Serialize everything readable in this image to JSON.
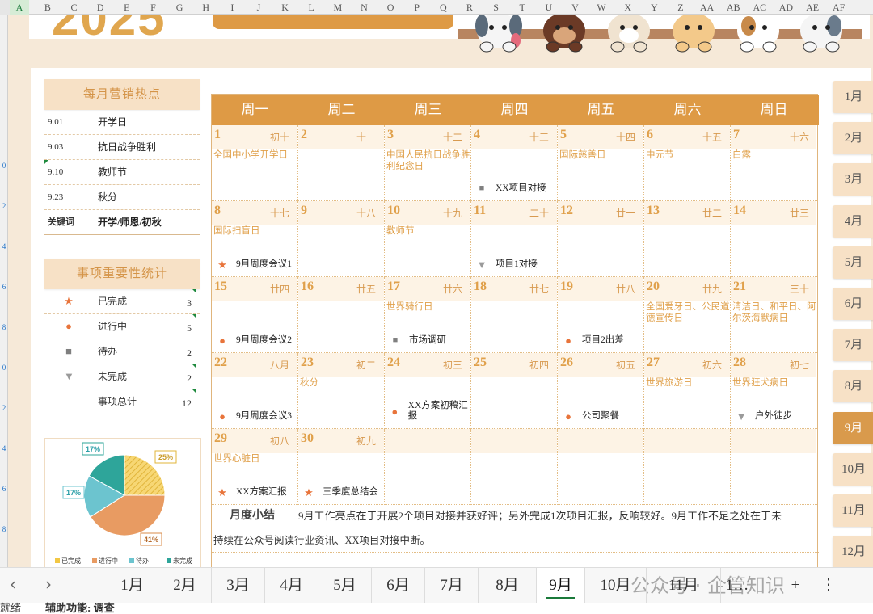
{
  "spreadsheet": {
    "columns": [
      "A",
      "B",
      "C",
      "D",
      "E",
      "F",
      "G",
      "H",
      "I",
      "J",
      "K",
      "L",
      "M",
      "N",
      "O",
      "P",
      "Q",
      "R",
      "S",
      "T",
      "U",
      "V",
      "W",
      "X",
      "Y",
      "Z",
      "AA",
      "AB",
      "AC",
      "AD",
      "AE",
      "AF"
    ],
    "selected_column": "A",
    "row_numbers": [
      "0",
      "2",
      "4",
      "6",
      "8",
      "0",
      "2",
      "4",
      "6",
      "8"
    ]
  },
  "header": {
    "year": "2025"
  },
  "marketing": {
    "title": "每月营销热点",
    "rows": [
      {
        "date": "9.01",
        "text": "开学日"
      },
      {
        "date": "9.03",
        "text": "抗日战争胜利"
      },
      {
        "date": "9.10",
        "text": "教师节"
      },
      {
        "date": "9.23",
        "text": "秋分"
      }
    ],
    "keyword_label": "关键词",
    "keyword_value": "开学/师恩/初秋"
  },
  "stats": {
    "title": "事项重要性统计",
    "rows": [
      {
        "icon": "★",
        "label": "已完成",
        "count": "3",
        "color": "#e8743b"
      },
      {
        "icon": "●",
        "label": "进行中",
        "count": "5",
        "color": "#e8743b"
      },
      {
        "icon": "■",
        "label": "待办",
        "count": "2",
        "color": "#7f7f7f"
      },
      {
        "icon": "▼",
        "label": "未完成",
        "count": "2",
        "color": "#9a9a9a"
      }
    ],
    "total_label": "事项总计",
    "total_count": "12"
  },
  "chart_data": {
    "type": "pie",
    "slices": [
      {
        "name": "已完成",
        "value": 25,
        "label": "25%",
        "color": "#f2c744"
      },
      {
        "name": "进行中",
        "value": 41,
        "label": "41%",
        "color": "#e89b62"
      },
      {
        "name": "待办",
        "value": 17,
        "label": "17%",
        "color": "#6cc4cf"
      },
      {
        "name": "未完成",
        "value": 17,
        "label": "17%",
        "color": "#2ea59a"
      }
    ],
    "legend": [
      "已完成",
      "进行中",
      "待办",
      "未完成"
    ],
    "legend_position": "bottom"
  },
  "calendar": {
    "weekdays": [
      "周一",
      "周二",
      "周三",
      "周四",
      "周五",
      "周六",
      "周日"
    ],
    "weeks": [
      [
        {
          "day": "1",
          "lunar": "初十",
          "festival": "全国中小学开学日",
          "task": "",
          "mark": ""
        },
        {
          "day": "2",
          "lunar": "十一",
          "festival": "",
          "task": "",
          "mark": ""
        },
        {
          "day": "3",
          "lunar": "十二",
          "festival": "中国人民抗日战争胜利纪念日",
          "task": "",
          "mark": ""
        },
        {
          "day": "4",
          "lunar": "十三",
          "festival": "",
          "task": "XX项目对接",
          "mark": "■"
        },
        {
          "day": "5",
          "lunar": "十四",
          "festival": "国际慈善日",
          "task": "",
          "mark": ""
        },
        {
          "day": "6",
          "lunar": "十五",
          "festival": "中元节",
          "task": "",
          "mark": ""
        },
        {
          "day": "7",
          "lunar": "十六",
          "festival": "白露",
          "task": "",
          "mark": ""
        }
      ],
      [
        {
          "day": "8",
          "lunar": "十七",
          "festival": "国际扫盲日",
          "task": "9月周度会议1",
          "mark": "★"
        },
        {
          "day": "9",
          "lunar": "十八",
          "festival": "",
          "task": "",
          "mark": ""
        },
        {
          "day": "10",
          "lunar": "十九",
          "festival": "教师节",
          "task": "",
          "mark": ""
        },
        {
          "day": "11",
          "lunar": "二十",
          "festival": "",
          "task": "项目1对接",
          "mark": "▼"
        },
        {
          "day": "12",
          "lunar": "廿一",
          "festival": "",
          "task": "",
          "mark": ""
        },
        {
          "day": "13",
          "lunar": "廿二",
          "festival": "",
          "task": "",
          "mark": ""
        },
        {
          "day": "14",
          "lunar": "廿三",
          "festival": "",
          "task": "",
          "mark": ""
        }
      ],
      [
        {
          "day": "15",
          "lunar": "廿四",
          "festival": "",
          "task": "9月周度会议2",
          "mark": "●"
        },
        {
          "day": "16",
          "lunar": "廿五",
          "festival": "",
          "task": "",
          "mark": ""
        },
        {
          "day": "17",
          "lunar": "廿六",
          "festival": "世界骑行日",
          "task": "市场调研",
          "mark": "■"
        },
        {
          "day": "18",
          "lunar": "廿七",
          "festival": "",
          "task": "",
          "mark": ""
        },
        {
          "day": "19",
          "lunar": "廿八",
          "festival": "",
          "task": "项目2出差",
          "mark": "●"
        },
        {
          "day": "20",
          "lunar": "廿九",
          "festival": "全国爱牙日、公民道德宣传日",
          "task": "",
          "mark": ""
        },
        {
          "day": "21",
          "lunar": "三十",
          "festival": "清洁日、和平日、阿尔茨海默病日",
          "task": "",
          "mark": ""
        }
      ],
      [
        {
          "day": "22",
          "lunar": "八月",
          "festival": "",
          "task": "9月周度会议3",
          "mark": "●"
        },
        {
          "day": "23",
          "lunar": "初二",
          "festival": "秋分",
          "task": "",
          "mark": ""
        },
        {
          "day": "24",
          "lunar": "初三",
          "festival": "",
          "task": "XX方案初稿汇报",
          "mark": "●"
        },
        {
          "day": "25",
          "lunar": "初四",
          "festival": "",
          "task": "",
          "mark": ""
        },
        {
          "day": "26",
          "lunar": "初五",
          "festival": "",
          "task": "公司聚餐",
          "mark": "●"
        },
        {
          "day": "27",
          "lunar": "初六",
          "festival": "世界旅游日",
          "task": "",
          "mark": ""
        },
        {
          "day": "28",
          "lunar": "初七",
          "festival": "世界狂犬病日",
          "task": "户外徒步",
          "mark": "▼"
        }
      ],
      [
        {
          "day": "29",
          "lunar": "初八",
          "festival": "世界心脏日",
          "task": "XX方案汇报",
          "mark": "★"
        },
        {
          "day": "30",
          "lunar": "初九",
          "festival": "",
          "task": "三季度总结会",
          "mark": "★"
        },
        {
          "day": "",
          "lunar": "",
          "festival": "",
          "task": "",
          "mark": ""
        },
        {
          "day": "",
          "lunar": "",
          "festival": "",
          "task": "",
          "mark": ""
        },
        {
          "day": "",
          "lunar": "",
          "festival": "",
          "task": "",
          "mark": ""
        },
        {
          "day": "",
          "lunar": "",
          "festival": "",
          "task": "",
          "mark": ""
        },
        {
          "day": "",
          "lunar": "",
          "festival": "",
          "task": "",
          "mark": ""
        }
      ]
    ],
    "mark_colors": {
      "★": "#e8743b",
      "●": "#e8743b",
      "■": "#7f7f7f",
      "▼": "#9a9a9a"
    }
  },
  "summary": {
    "label": "月度小结",
    "line1": "9月工作亮点在于开展2个项目对接并获好评；另外完成1次项目汇报，反响较好。9月工作不足之处在于未",
    "line2": "持续在公众号阅读行业资讯、XX项目对接中断。"
  },
  "month_buttons": [
    "1月",
    "2月",
    "3月",
    "4月",
    "5月",
    "6月",
    "7月",
    "8月",
    "9月",
    "10月",
    "11月",
    "12月"
  ],
  "active_month": "9月",
  "tabs": {
    "prev": "‹",
    "next": "›",
    "items": [
      "1月",
      "2月",
      "3月",
      "4月",
      "5月",
      "6月",
      "7月",
      "8月",
      "9月",
      "10月",
      "11月",
      "1…",
      "+",
      "⋮"
    ],
    "active": "9月"
  },
  "watermark": "公众号 · 企管知识",
  "status": {
    "left": "就绪",
    "accessibility": "辅助功能: 调查"
  }
}
